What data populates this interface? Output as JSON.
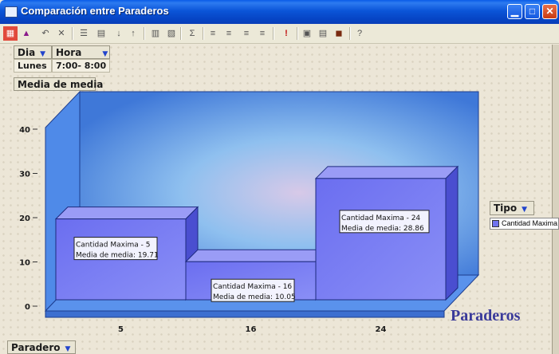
{
  "window": {
    "title": "Comparación entre Paraderos",
    "buttons": [
      "minimize",
      "maximize",
      "close"
    ]
  },
  "toolbar": {
    "icons": [
      "chart-wizard-icon",
      "chart-type-icon",
      "undo-icon",
      "delete-icon",
      "table-icon",
      "field-list-icon",
      "sort-ascending-icon",
      "sort-descending-icon",
      "filter-icon",
      "show-details-icon",
      "autocalc-icon",
      "subtotals-icon",
      "expand-icon",
      "collapse-icon",
      "hide-details-icon",
      "refresh-icon",
      "export-icon",
      "properties-icon",
      "commands-icon",
      "help-icon"
    ]
  },
  "filters": {
    "dia_label": "Dia",
    "hora_label": "Hora",
    "dia_value": "Lunes",
    "hora_value": "7:00- 8:00"
  },
  "data_field_label": "Media de media",
  "category_field_label": "Paradero",
  "series_field_label": "Tipo",
  "legend_label": "Cantidad Maxima",
  "chart_data": {
    "type": "bar",
    "categories": [
      "5",
      "16",
      "24"
    ],
    "values": [
      19.71,
      10.05,
      28.86
    ],
    "series": [
      {
        "name": "Cantidad Maxima",
        "values": [
          19.71,
          10.05,
          28.86
        ]
      }
    ],
    "data_labels": [
      [
        "Cantidad Maxima - 5",
        "Media de media: 19.71"
      ],
      [
        "Cantidad Maxima - 16",
        "Media de media: 10.05"
      ],
      [
        "Cantidad Maxima - 24",
        "Media de media: 28.86"
      ]
    ],
    "yticks": [
      "0",
      "10",
      "20",
      "30",
      "40"
    ],
    "ylim": [
      0,
      40
    ],
    "xlabel": "Paraderos",
    "colors": {
      "bar": "#6f73f0",
      "back_wall": "#7fb0f0",
      "side_wall": "#4f8ae8",
      "floor": "#5a92ec"
    }
  }
}
